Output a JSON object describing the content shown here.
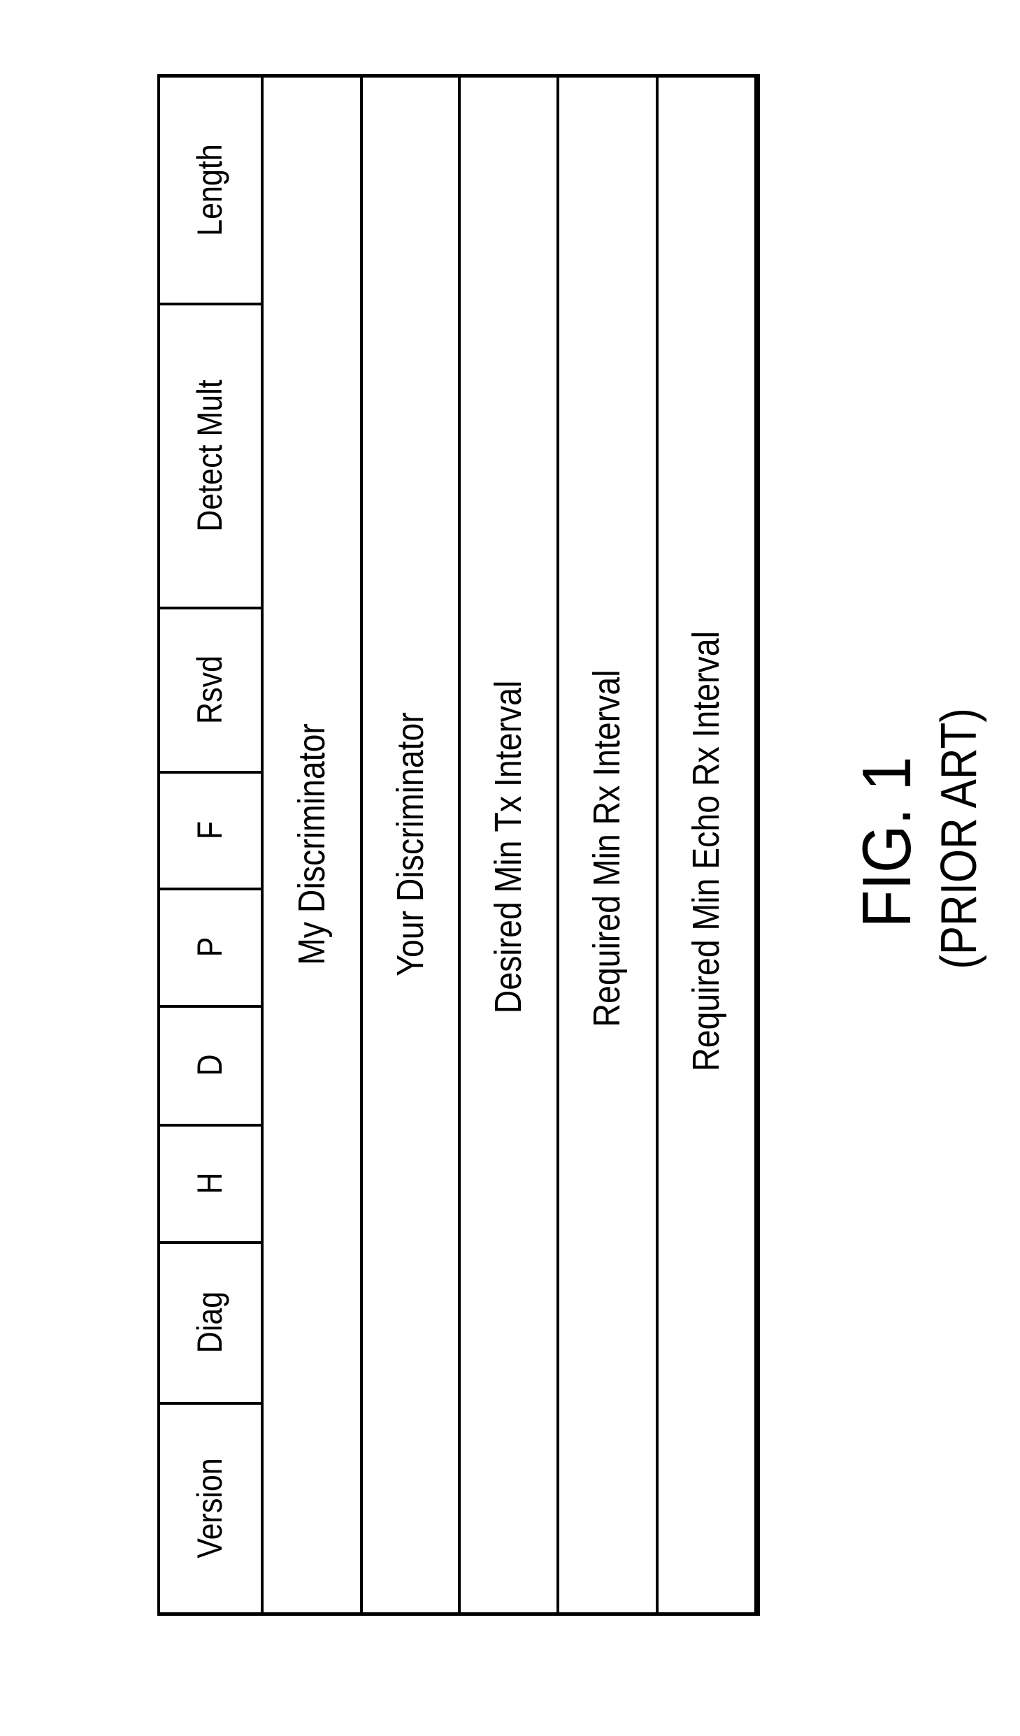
{
  "figure": {
    "title": "FIG. 1",
    "subtitle": "(PRIOR ART)"
  },
  "header_fields": [
    {
      "label": "Version"
    },
    {
      "label": "Diag"
    },
    {
      "label": "H"
    },
    {
      "label": "D"
    },
    {
      "label": "P"
    },
    {
      "label": "F"
    },
    {
      "label": "Rsvd"
    },
    {
      "label": "Detect Mult"
    },
    {
      "label": "Length"
    }
  ],
  "rows": [
    {
      "label": "My Discriminator"
    },
    {
      "label": "Your Discriminator"
    },
    {
      "label": "Desired Min Tx Interval"
    },
    {
      "label": "Required Min Rx Interval"
    },
    {
      "label": "Required Min Echo Rx Interval"
    }
  ]
}
